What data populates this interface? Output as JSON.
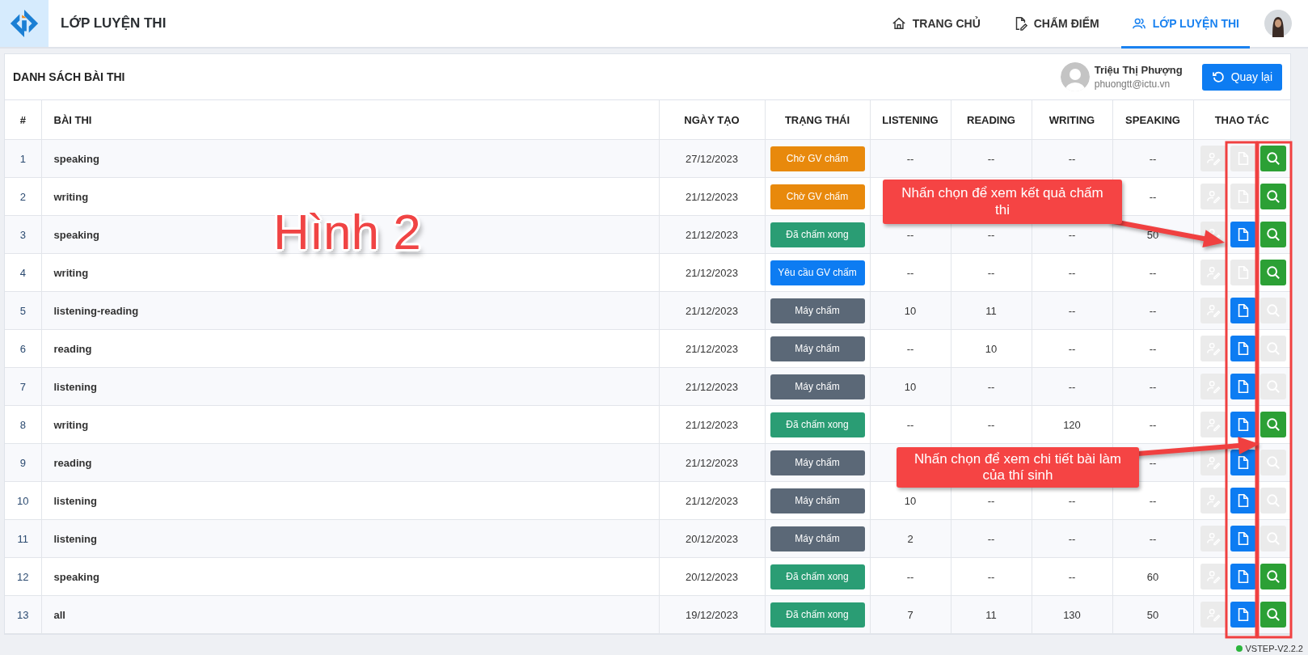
{
  "header": {
    "title": "LỚP LUYỆN THI",
    "nav": [
      {
        "label": "TRANG CHỦ",
        "selected": false
      },
      {
        "label": "CHẤM ĐIỂM",
        "selected": false
      },
      {
        "label": "LỚP LUYỆN THI",
        "selected": true
      }
    ]
  },
  "card": {
    "title": "DANH SÁCH BÀI THI",
    "user": {
      "name": "Triệu Thị Phượng",
      "email": "phuongtt@ictu.vn"
    },
    "back_button": "Quay lại"
  },
  "table": {
    "columns": [
      "#",
      "BÀI THI",
      "NGÀY TẠO",
      "TRẠNG THÁI",
      "LISTENING",
      "READING",
      "WRITING",
      "SPEAKING",
      "THAO TÁC"
    ],
    "rows": [
      {
        "index": "1",
        "name": "speaking",
        "date": "27/12/2023",
        "status": {
          "label": "Chờ GV chấm",
          "color": "#e8890c"
        },
        "scores": [
          "--",
          "--",
          "--",
          "--"
        ],
        "grade_enabled": false,
        "result_enabled": false,
        "detail_enabled": true
      },
      {
        "index": "2",
        "name": "writing",
        "date": "21/12/2023",
        "status": {
          "label": "Chờ GV chấm",
          "color": "#e8890c"
        },
        "scores": {
          "speaking": "--"
        },
        "grade_enabled": false,
        "result_enabled": false,
        "detail_enabled": true
      },
      {
        "index": "3",
        "name": "speaking",
        "date": "21/12/2023",
        "status": {
          "label": "Đã chấm xong",
          "color": "#2a9d74"
        },
        "scores": [
          "--",
          "--",
          "--",
          "50"
        ],
        "grade_enabled": false,
        "result_enabled": true,
        "detail_enabled": true
      },
      {
        "index": "4",
        "name": "writing",
        "date": "21/12/2023",
        "status": {
          "label": "Yêu cầu GV chấm",
          "color": "#0d7cf2"
        },
        "scores": [
          "--",
          "--",
          "--",
          "--"
        ],
        "grade_enabled": false,
        "result_enabled": false,
        "detail_enabled": true
      },
      {
        "index": "5",
        "name": "listening-reading",
        "date": "21/12/2023",
        "status": {
          "label": "Máy chấm",
          "color": "#5b6877"
        },
        "scores": [
          "10",
          "11",
          "--",
          "--"
        ],
        "grade_enabled": false,
        "result_enabled": true,
        "detail_enabled": false
      },
      {
        "index": "6",
        "name": "reading",
        "date": "21/12/2023",
        "status": {
          "label": "Máy chấm",
          "color": "#5b6877"
        },
        "scores": [
          "--",
          "10",
          "--",
          "--"
        ],
        "grade_enabled": false,
        "result_enabled": true,
        "detail_enabled": false
      },
      {
        "index": "7",
        "name": "listening",
        "date": "21/12/2023",
        "status": {
          "label": "Máy chấm",
          "color": "#5b6877"
        },
        "scores": [
          "10",
          "--",
          "--",
          "--"
        ],
        "grade_enabled": false,
        "result_enabled": true,
        "detail_enabled": false
      },
      {
        "index": "8",
        "name": "writing",
        "date": "21/12/2023",
        "status": {
          "label": "Đã chấm xong",
          "color": "#2a9d74"
        },
        "scores": [
          "--",
          "--",
          "120",
          "--"
        ],
        "grade_enabled": false,
        "result_enabled": true,
        "detail_enabled": true
      },
      {
        "index": "9",
        "name": "reading",
        "date": "21/12/2023",
        "status": {
          "label": "Máy chấm",
          "color": "#5b6877"
        },
        "scores": {
          "speaking": "--"
        },
        "grade_enabled": false,
        "result_enabled": true,
        "detail_enabled": false
      },
      {
        "index": "10",
        "name": "listening",
        "date": "21/12/2023",
        "status": {
          "label": "Máy chấm",
          "color": "#5b6877"
        },
        "scores": [
          "10",
          "--",
          "--",
          "--"
        ],
        "grade_enabled": false,
        "result_enabled": true,
        "detail_enabled": false
      },
      {
        "index": "11",
        "name": "listening",
        "date": "20/12/2023",
        "status": {
          "label": "Máy chấm",
          "color": "#5b6877"
        },
        "scores": [
          "2",
          "--",
          "--",
          "--"
        ],
        "grade_enabled": false,
        "result_enabled": true,
        "detail_enabled": false
      },
      {
        "index": "12",
        "name": "speaking",
        "date": "20/12/2023",
        "status": {
          "label": "Đã chấm xong",
          "color": "#2a9d74"
        },
        "scores": [
          "--",
          "--",
          "--",
          "60"
        ],
        "grade_enabled": false,
        "result_enabled": true,
        "detail_enabled": true
      },
      {
        "index": "13",
        "name": "all",
        "date": "19/12/2023",
        "status": {
          "label": "Đã chấm xong",
          "color": "#2a9d74"
        },
        "scores": [
          "7",
          "11",
          "130",
          "50"
        ],
        "grade_enabled": false,
        "result_enabled": true,
        "detail_enabled": true
      }
    ]
  },
  "version": "VSTEP-V2.2.2",
  "annotations": {
    "figure_label": "Hình 2",
    "callouts": [
      {
        "text": "Nhấn chọn để xem kết quả chấm thi"
      },
      {
        "text": "Nhấn chọn để xem chi tiết bài làm của thí sinh"
      }
    ]
  }
}
